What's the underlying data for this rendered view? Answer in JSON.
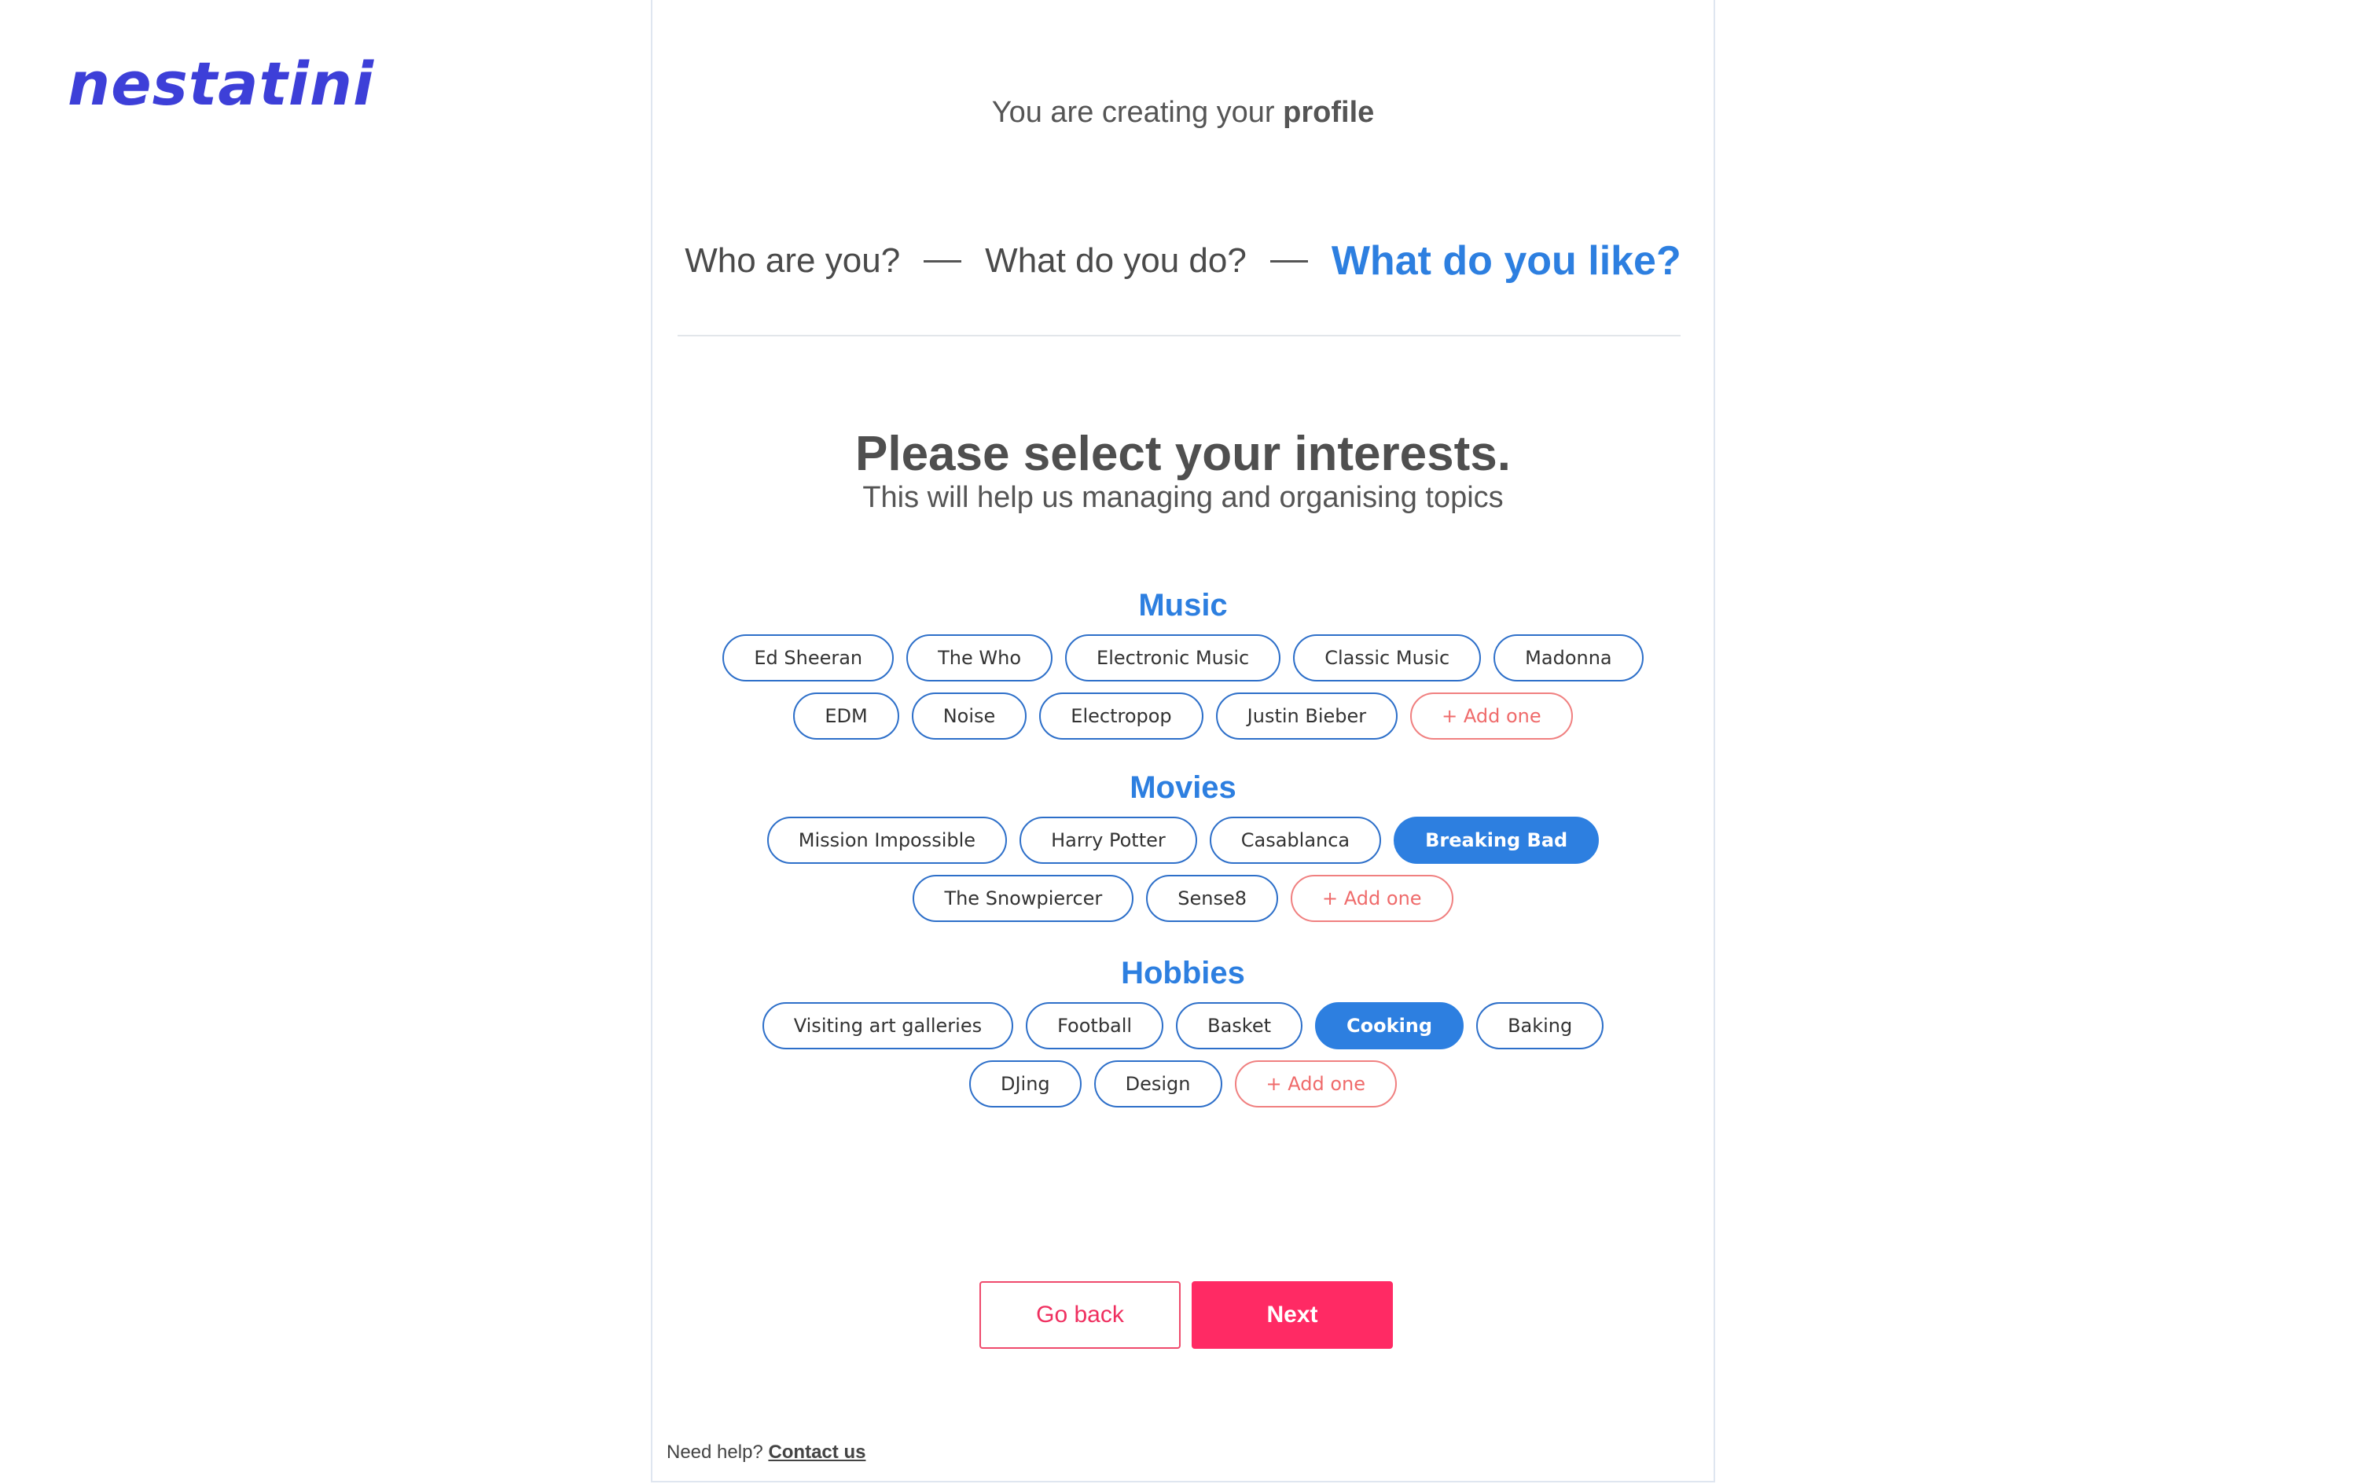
{
  "brand": {
    "logo_text": "nestatini",
    "logo_color": "#3d3fd8"
  },
  "header": {
    "creating_prefix": "You are creating your",
    "creating_bold": "profile"
  },
  "steps": {
    "step1": "Who are you?",
    "step2": "What do you do?",
    "step3": "What do you like?",
    "active_step": 3
  },
  "main": {
    "title": "Please select your interests.",
    "subtitle": "This will help us managing and organising topics"
  },
  "sections": {
    "music": {
      "heading": "Music",
      "row1": [
        "Ed Sheeran",
        "The Who",
        "Electronic Music",
        "Classic Music",
        "Madonna"
      ],
      "row2": [
        "EDM",
        "Noise",
        "Electropop",
        "Justin Bieber"
      ],
      "add_label": "+ Add one"
    },
    "movies": {
      "heading": "Movies",
      "row1": [
        "Mission Impossible",
        "Harry Potter",
        "Casablanca",
        "Breaking Bad"
      ],
      "row2": [
        "The Snowpiercer",
        "Sense8"
      ],
      "selected": [
        "Breaking Bad"
      ],
      "add_label": "+ Add one"
    },
    "hobbies": {
      "heading": "Hobbies",
      "row1": [
        "Visiting art galleries",
        "Football",
        "Basket",
        "Cooking",
        "Baking"
      ],
      "row2": [
        "DJing",
        "Design"
      ],
      "selected": [
        "Cooking"
      ],
      "add_label": "+ Add one"
    }
  },
  "actions": {
    "back_label": "Go back",
    "next_label": "Next"
  },
  "footer": {
    "help_text": "Need help?",
    "contact_label": "Contact us"
  },
  "colors": {
    "accent_blue": "#2d7fe0",
    "primary_pink": "#ff2a64",
    "add_red": "#ef6b6b"
  }
}
